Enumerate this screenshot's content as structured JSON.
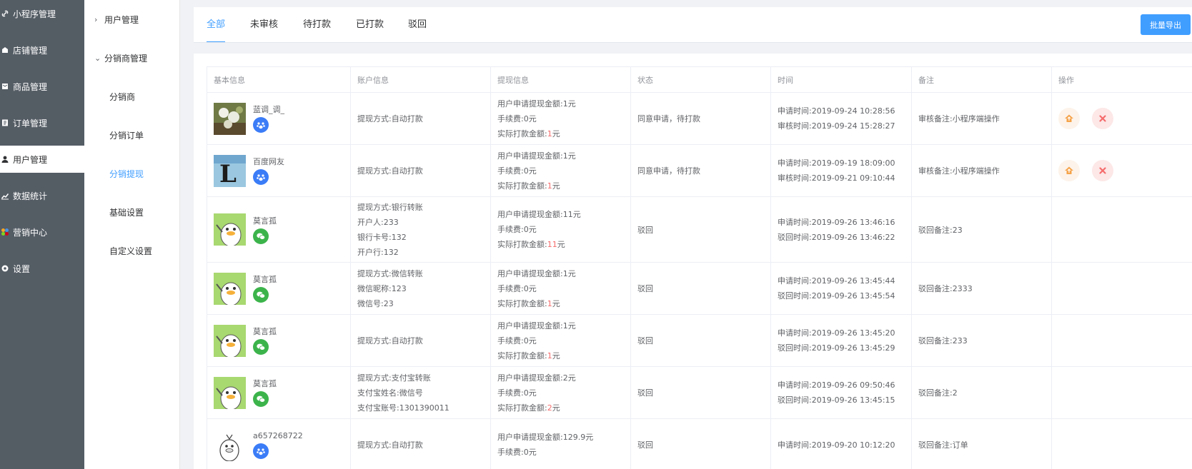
{
  "nav": {
    "items": [
      {
        "label": "小程序管理",
        "icon": "link-icon",
        "active": false
      },
      {
        "label": "店铺管理",
        "icon": "shop-icon",
        "active": false
      },
      {
        "label": "商品管理",
        "icon": "goods-icon",
        "active": false
      },
      {
        "label": "订单管理",
        "icon": "order-icon",
        "active": false
      },
      {
        "label": "用户管理",
        "icon": "user-icon",
        "active": true
      },
      {
        "label": "数据统计",
        "icon": "chart-icon",
        "active": false
      },
      {
        "label": "营销中心",
        "icon": "marketing-icon",
        "active": false
      },
      {
        "label": "设置",
        "icon": "gear-icon",
        "active": false
      }
    ]
  },
  "submenu": {
    "group1": "用户管理",
    "group2": "分销商管理",
    "children": [
      "分销商",
      "分销订单",
      "分销提现",
      "基础设置",
      "自定义设置"
    ],
    "active_child": "分销提现"
  },
  "tabs": {
    "items": [
      "全部",
      "未审核",
      "待打款",
      "已打款",
      "驳回"
    ],
    "active": "全部",
    "export_label": "批量导出"
  },
  "colors": {
    "accent": "#409eff",
    "nav_bg": "#545c64",
    "amount_red": "#f56c6c"
  },
  "table": {
    "headers": [
      "基本信息",
      "账户信息",
      "提现信息",
      "状态",
      "时间",
      "备注",
      "操作"
    ],
    "rows": [
      {
        "name": "蓝调_调_",
        "avatar": "flower-photo",
        "badge": "blue",
        "account": [
          "提现方式:自动打款"
        ],
        "apply": "用户申请提现金额:1元",
        "fee": "手续费:0元",
        "paid_prefix": "实际打款金额:",
        "paid_amount": "1",
        "paid_unit": "元",
        "status": "同意申请，待打款",
        "time1": "申请时间:2019-09-24 10:28:56",
        "time2": "审核时间:2019-09-24 15:28:27",
        "note": "审核备注:小程序端操作",
        "has_ops": true
      },
      {
        "name": "百度网友",
        "avatar": "letter-l",
        "badge": "blue",
        "account": [
          "提现方式:自动打款"
        ],
        "apply": "用户申请提现金额:1元",
        "fee": "手续费:0元",
        "paid_prefix": "实际打款金额:",
        "paid_amount": "1",
        "paid_unit": "元",
        "status": "同意申请，待打款",
        "time1": "申请时间:2019-09-19 18:09:00",
        "time2": "审核时间:2019-09-21 09:10:44",
        "note": "审核备注:小程序端操作",
        "has_ops": true
      },
      {
        "name": "莫言孤",
        "avatar": "duck-green",
        "badge": "green",
        "account": [
          "提现方式:银行转账",
          "开户人:233",
          "银行卡号:132",
          "开户行:132"
        ],
        "apply": "用户申请提现金额:11元",
        "fee": "手续费:0元",
        "paid_prefix": "实际打款金额:",
        "paid_amount": "11",
        "paid_unit": "元",
        "status": "驳回",
        "time1": "申请时间:2019-09-26 13:46:16",
        "time2": "驳回时间:2019-09-26 13:46:22",
        "note": "驳回备注:23",
        "has_ops": false
      },
      {
        "name": "莫言孤",
        "avatar": "duck-green",
        "badge": "green",
        "account": [
          "提现方式:微信转账",
          "微信昵称:123",
          "微信号:23"
        ],
        "apply": "用户申请提现金额:1元",
        "fee": "手续费:0元",
        "paid_prefix": "实际打款金额:",
        "paid_amount": "1",
        "paid_unit": "元",
        "status": "驳回",
        "time1": "申请时间:2019-09-26 13:45:44",
        "time2": "驳回时间:2019-09-26 13:45:54",
        "note": "驳回备注:2333",
        "has_ops": false
      },
      {
        "name": "莫言孤",
        "avatar": "duck-green",
        "badge": "green",
        "account": [
          "提现方式:自动打款"
        ],
        "apply": "用户申请提现金额:1元",
        "fee": "手续费:0元",
        "paid_prefix": "实际打款金额:",
        "paid_amount": "1",
        "paid_unit": "元",
        "status": "驳回",
        "time1": "申请时间:2019-09-26 13:45:20",
        "time2": "驳回时间:2019-09-26 13:45:29",
        "note": "驳回备注:233",
        "has_ops": false
      },
      {
        "name": "莫言孤",
        "avatar": "duck-green",
        "badge": "green",
        "account": [
          "提现方式:支付宝转账",
          "支付宝姓名:微信号",
          "支付宝账号:1301390011"
        ],
        "apply": "用户申请提现金额:2元",
        "fee": "手续费:0元",
        "paid_prefix": "实际打款金额:",
        "paid_amount": "2",
        "paid_unit": "元",
        "status": "驳回",
        "time1": "申请时间:2019-09-26 09:50:46",
        "time2": "驳回时间:2019-09-26 13:45:15",
        "note": "驳回备注:2",
        "has_ops": false
      },
      {
        "name": "a657268722",
        "avatar": "duck-white",
        "badge": "blue",
        "account": [
          "提现方式:自动打款"
        ],
        "apply": "用户申请提现金额:129.9元",
        "fee": "手续费:0元",
        "paid_prefix": "",
        "paid_amount": "",
        "paid_unit": "",
        "status": "驳回",
        "time1": "申请时间:2019-09-20 10:12:20",
        "time2": "",
        "note": "驳回备注:订单",
        "has_ops": false
      }
    ]
  }
}
